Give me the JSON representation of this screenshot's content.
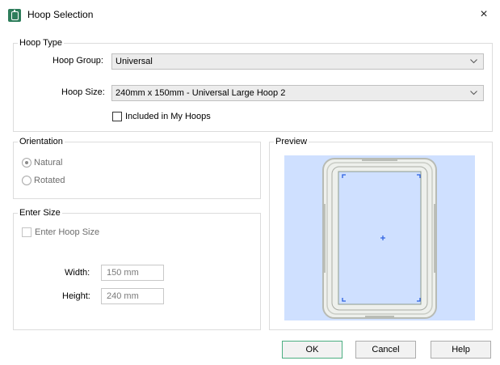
{
  "window": {
    "title": "Hoop Selection",
    "close_glyph": "×",
    "app_icon": "hoop-icon"
  },
  "hoop_type": {
    "legend": "Hoop Type",
    "group_label": "Hoop Group:",
    "group_value": "Universal",
    "size_label": "Hoop Size:",
    "size_value": "240mm x 150mm - Universal Large Hoop 2",
    "included_label": "Included in My Hoops",
    "included_checked": false
  },
  "orientation": {
    "legend": "Orientation",
    "options": [
      {
        "label": "Natural",
        "selected": true
      },
      {
        "label": "Rotated",
        "selected": false
      }
    ]
  },
  "enter_size": {
    "legend": "Enter Size",
    "checkbox_label": "Enter Hoop Size",
    "checked": false,
    "width_label": "Width:",
    "width_value": "150 mm",
    "height_label": "Height:",
    "height_value": "240 mm"
  },
  "preview": {
    "legend": "Preview",
    "background": "#cfe0ff"
  },
  "buttons": {
    "ok": "OK",
    "cancel": "Cancel",
    "help": "Help"
  },
  "colors": {
    "default_button_border": "#4caf82",
    "app_icon": "#2e7d5b",
    "corner_marks": "#2b5fe0"
  }
}
